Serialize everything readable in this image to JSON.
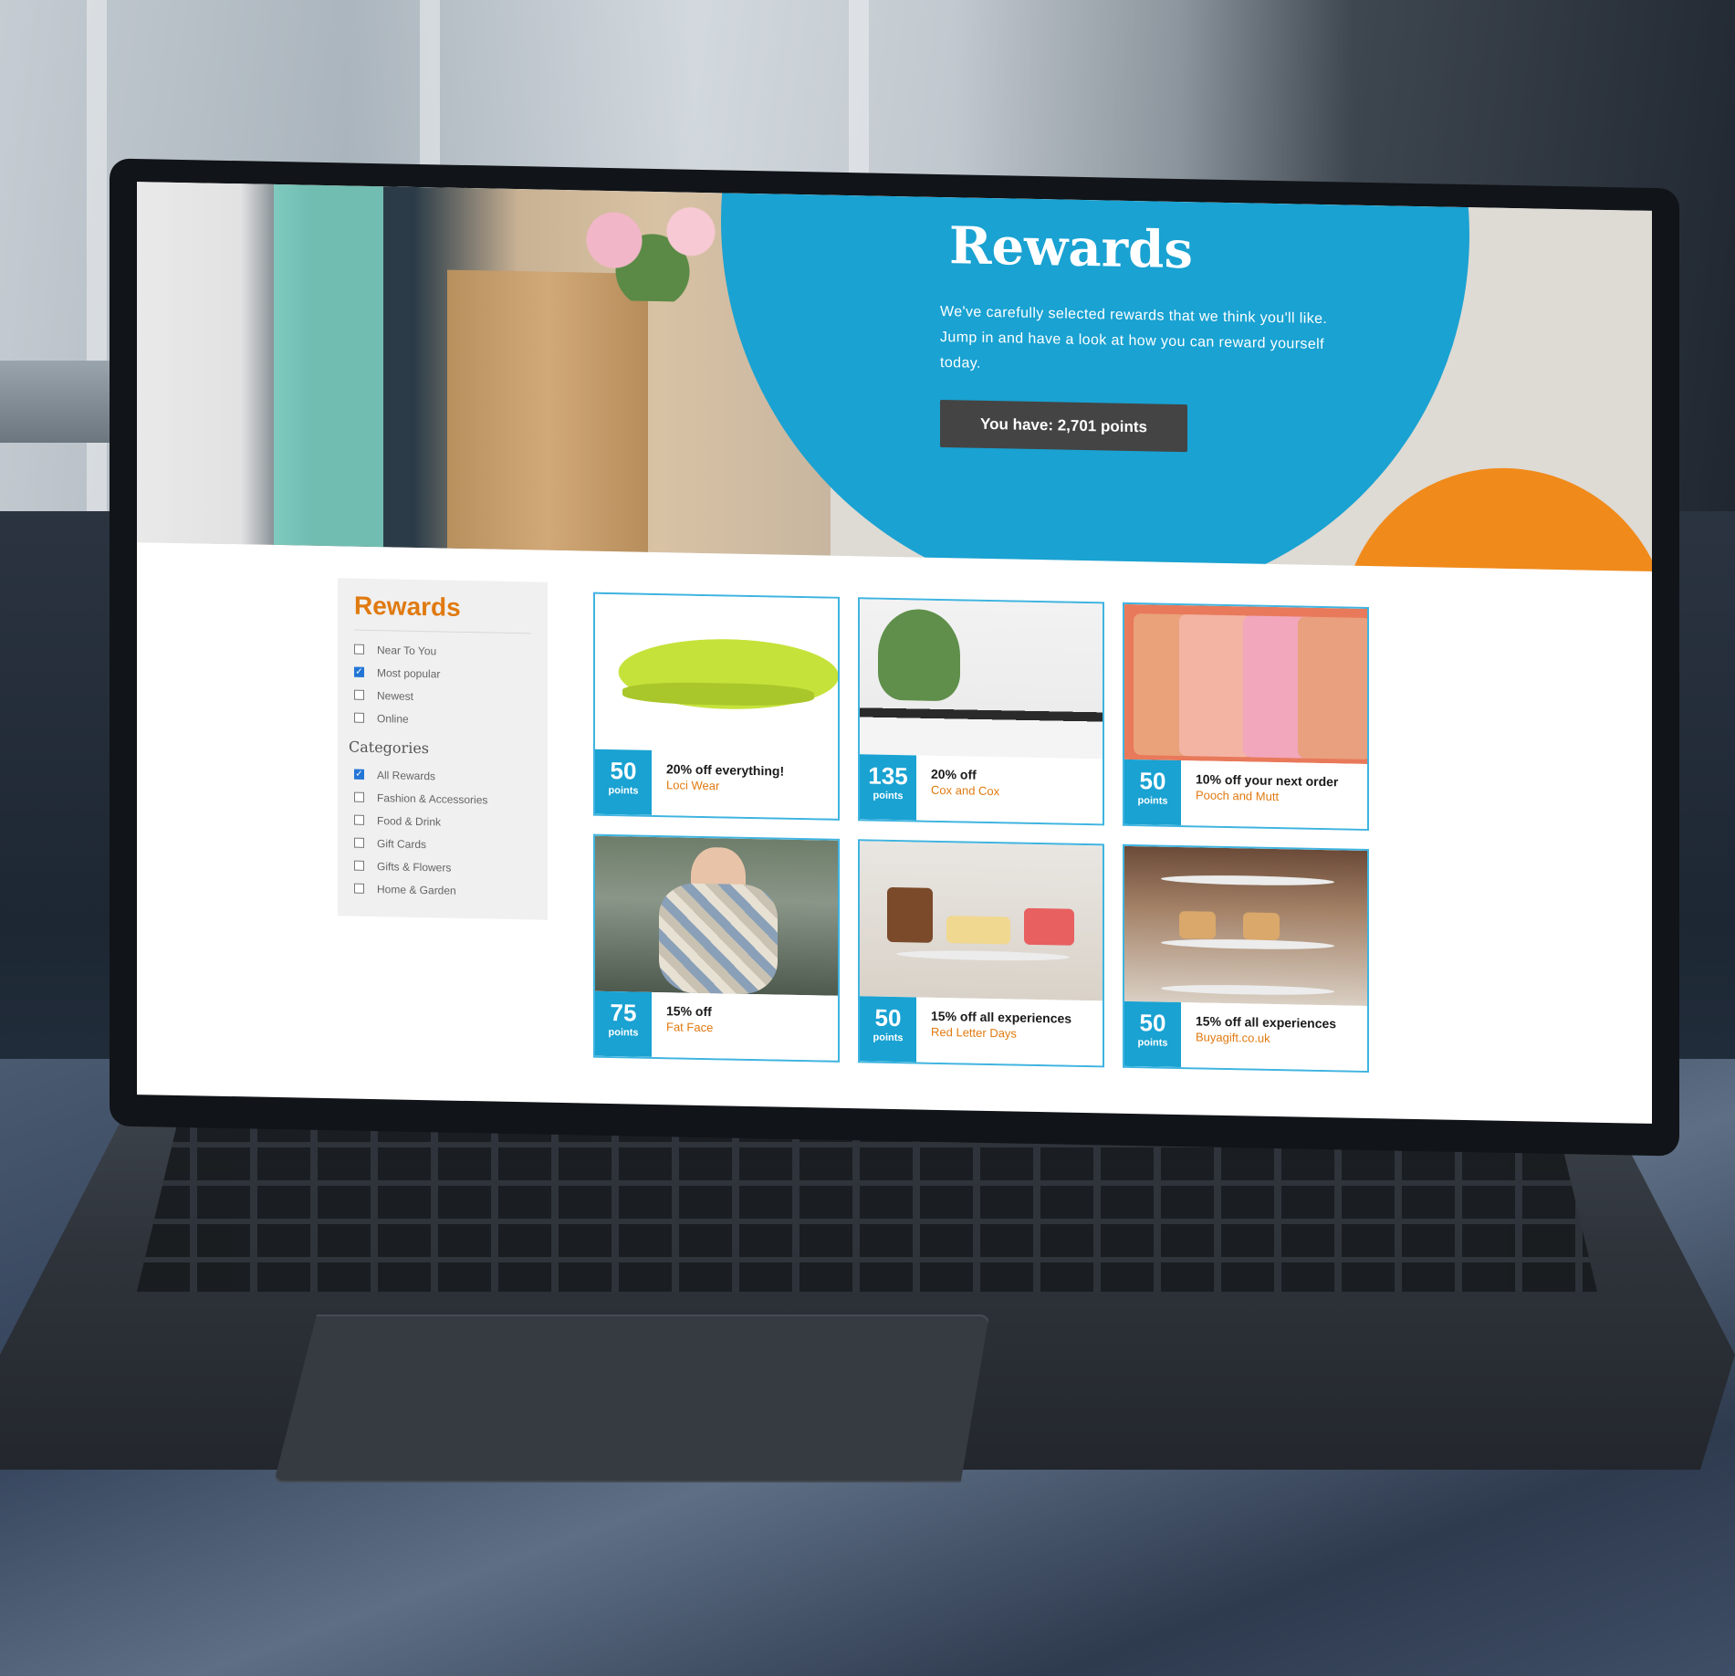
{
  "hero": {
    "title": "Rewards",
    "text": "We've carefully selected rewards that we think you'll like. Jump in and have a look at how you can reward yourself today.",
    "points_button": "You have: 2,701 points"
  },
  "sidebar": {
    "title": "Rewards",
    "filters": [
      {
        "label": "Near To You",
        "checked": false
      },
      {
        "label": "Most popular",
        "checked": true
      },
      {
        "label": "Newest",
        "checked": false
      },
      {
        "label": "Online",
        "checked": false
      }
    ],
    "categories_heading": "Categories",
    "categories": [
      {
        "label": "All Rewards",
        "checked": true
      },
      {
        "label": "Fashion & Accessories",
        "checked": false
      },
      {
        "label": "Food & Drink",
        "checked": false
      },
      {
        "label": "Gift Cards",
        "checked": false
      },
      {
        "label": "Gifts & Flowers",
        "checked": false
      },
      {
        "label": "Home & Garden",
        "checked": false
      }
    ]
  },
  "cards": [
    {
      "points": "50",
      "unit": "points",
      "offer": "20% off everything!",
      "brand": "Loci Wear"
    },
    {
      "points": "135",
      "unit": "points",
      "offer": "20% off",
      "brand": "Cox and Cox"
    },
    {
      "points": "50",
      "unit": "points",
      "offer": "10% off your next order",
      "brand": "Pooch and Mutt"
    },
    {
      "points": "75",
      "unit": "points",
      "offer": "15% off",
      "brand": "Fat Face"
    },
    {
      "points": "50",
      "unit": "points",
      "offer": "15% off all experiences",
      "brand": "Red Letter Days"
    },
    {
      "points": "50",
      "unit": "points",
      "offer": "15% off all experiences",
      "brand": "Buyagift.co.uk"
    }
  ],
  "colors": {
    "accent_blue": "#19a2d2",
    "accent_orange": "#e07a10",
    "button_dark": "#444444"
  }
}
